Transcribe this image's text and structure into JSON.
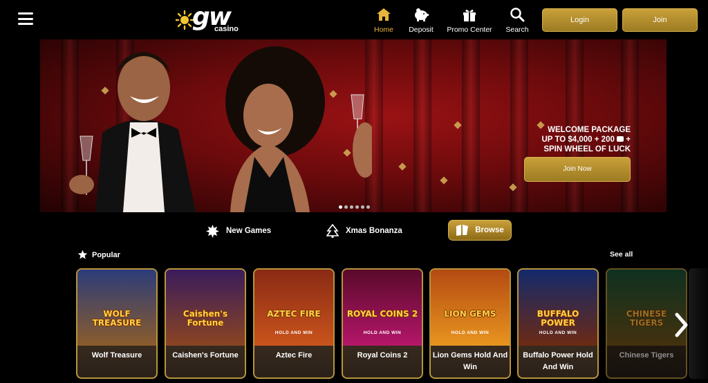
{
  "brand": {
    "logo_text": "gw",
    "logo_sub": "casino"
  },
  "nav": [
    {
      "label": "Home",
      "icon": "home-icon",
      "active": true
    },
    {
      "label": "Deposit",
      "icon": "piggy-bank-icon"
    },
    {
      "label": "Promo Center",
      "icon": "gift-icon"
    },
    {
      "label": "Search",
      "icon": "search-icon"
    }
  ],
  "auth": {
    "login_label": "Login",
    "join_label": "Join"
  },
  "hero": {
    "line1": "WELCOME PACKAGE",
    "line2": "UP TO $4,000 + 200",
    "line2_suffix": "+",
    "line3": "SPIN WHEEL OF LUCK",
    "cta_label": "Join Now",
    "slides": 6,
    "active_slide": 1
  },
  "categories": [
    {
      "label": "New Games",
      "icon": "sparkle-icon"
    },
    {
      "label": "Xmas Bonanza",
      "icon": "christmas-tree-icon"
    },
    {
      "label": "Browse",
      "icon": "book-icon",
      "selected": true
    }
  ],
  "popular": {
    "title": "Popular",
    "see_all": "See all",
    "games": [
      {
        "name": "Wolf Treasure",
        "art": "WOLF TREASURE",
        "art_sub": "",
        "bg_top": "#2c3c7a",
        "bg_bottom": "#8a5c2c"
      },
      {
        "name": "Caishen's Fortune",
        "art": "Caishen's Fortune",
        "art_sub": "",
        "bg_top": "#3a1c5c",
        "bg_bottom": "#8a4422"
      },
      {
        "name": "Aztec Fire",
        "art": "AZTEC FIRE",
        "art_sub": "HOLD AND WIN",
        "bg_top": "#8a2a14",
        "bg_bottom": "#c9541c"
      },
      {
        "name": "Royal Coins 2",
        "art": "ROYAL COINS 2",
        "art_sub": "HOLD AND WIN",
        "bg_top": "#5a0a2a",
        "bg_bottom": "#b4166a"
      },
      {
        "name": "Lion Gems Hold And Win",
        "art": "LION GEMS",
        "art_sub": "HOLD AND WIN",
        "bg_top": "#b44a12",
        "bg_bottom": "#e8951f"
      },
      {
        "name": "Buffalo Power Hold And Win",
        "art": "BUFFALO POWER",
        "art_sub": "HOLD AND WIN",
        "bg_top": "#142a6c",
        "bg_bottom": "#6c2a14"
      },
      {
        "name": "Chinese Tigers",
        "art": "CHINESE TIGERS",
        "art_sub": "",
        "bg_top": "#1c5a3a",
        "bg_bottom": "#7a5a1c"
      }
    ]
  },
  "colors": {
    "gold": "#c9a03a",
    "active_nav": "#e7b53b",
    "hero_red": "#7a0a0c"
  }
}
